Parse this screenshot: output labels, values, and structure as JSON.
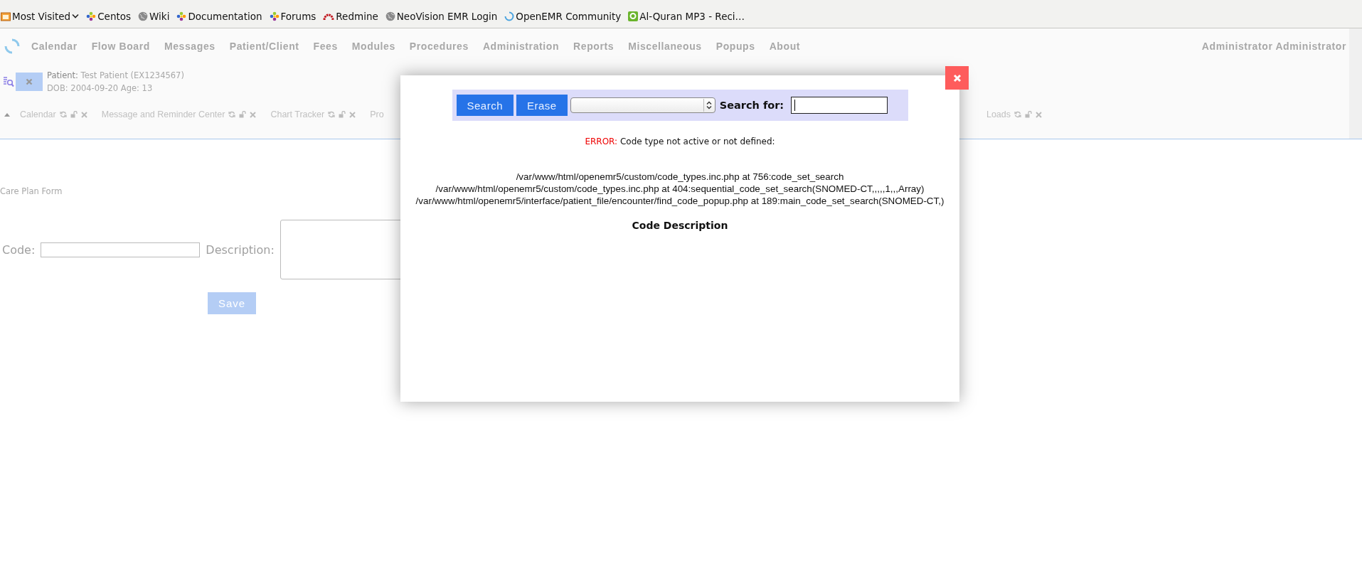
{
  "bookmarks": [
    {
      "label": "Most Visited",
      "kind": "folder",
      "dropdown": true
    },
    {
      "label": "Centos",
      "kind": "flower",
      "dropdown": false
    },
    {
      "label": "Wiki",
      "kind": "globe",
      "dropdown": false
    },
    {
      "label": "Documentation",
      "kind": "flower",
      "dropdown": false
    },
    {
      "label": "Forums",
      "kind": "flower",
      "dropdown": false
    },
    {
      "label": "Redmine",
      "kind": "arc",
      "dropdown": false
    },
    {
      "label": "NeoVision EMR Login",
      "kind": "globe",
      "dropdown": false
    },
    {
      "label": "OpenEMR Community",
      "kind": "ring",
      "dropdown": false
    },
    {
      "label": "Al-Quran MP3 - Reci…",
      "kind": "square",
      "dropdown": false
    }
  ],
  "menu": [
    "Calendar",
    "Flow Board",
    "Messages",
    "Patient/Client",
    "Fees",
    "Modules",
    "Procedures",
    "Administration",
    "Reports",
    "Miscellaneous",
    "Popups",
    "About"
  ],
  "user": "Administrator Administrator",
  "patient": {
    "label": "Patient:",
    "name": "Test Patient (EX1234567)",
    "dob": "DOB: 2004-09-20 Age: 13"
  },
  "tabs": [
    {
      "label": "Calendar",
      "kind": "full"
    },
    {
      "label": "Message and Reminder Center",
      "kind": "full"
    },
    {
      "label": "Chart Tracker",
      "kind": "full"
    },
    {
      "label": "Pro",
      "kind": "partial"
    },
    {
      "label": "Loads",
      "kind": "tail"
    }
  ],
  "form": {
    "title": "Care Plan Form",
    "code_label": "Code:",
    "description_label": "Description:",
    "save": "Save"
  },
  "dialog": {
    "search_button": "Search",
    "erase_button": "Erase",
    "search_for_label": "Search for:",
    "error_label": "ERROR:",
    "error_text": "Code type not active or not defined:",
    "trace": [
      "/var/www/html/openemr5/custom/code_types.inc.php at 756:code_set_search",
      "/var/www/html/openemr5/custom/code_types.inc.php at 404:sequential_code_set_search(SNOMED-CT,,,,,1,,,Array)",
      "/var/www/html/openemr5/interface/patient_file/encounter/find_code_popup.php at 189:main_code_set_search(SNOMED-CT,)"
    ],
    "heading": "Code Description"
  }
}
